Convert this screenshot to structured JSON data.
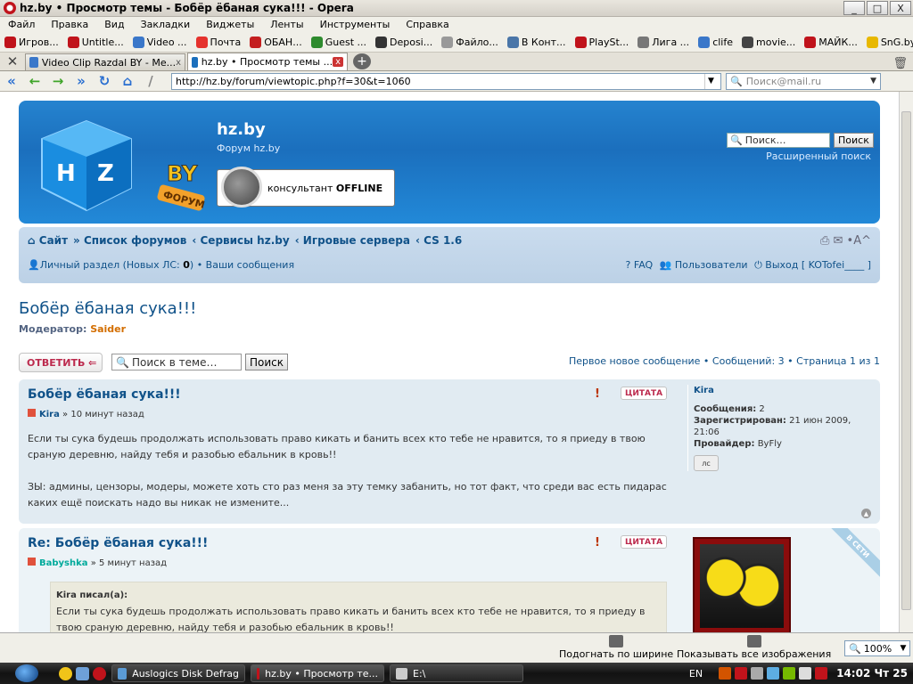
{
  "window": {
    "title": "hz.by • Просмотр темы - Бобёр ёбаная сука!!! - Opera",
    "min": "_",
    "max": "□",
    "close": "X"
  },
  "menu": [
    "Файл",
    "Правка",
    "Вид",
    "Закладки",
    "Виджеты",
    "Ленты",
    "Инструменты",
    "Справка"
  ],
  "bookmarks": [
    {
      "label": "Игров...",
      "color": "#c0131b"
    },
    {
      "label": "Untitle...",
      "color": "#c0131b"
    },
    {
      "label": "Video ...",
      "color": "#3a77c9"
    },
    {
      "label": "Почта",
      "color": "#e5322d"
    },
    {
      "label": "ОБАН...",
      "color": "#c41f1f"
    },
    {
      "label": "Guest ...",
      "color": "#2e8b2e"
    },
    {
      "label": "Deposi...",
      "color": "#333333"
    },
    {
      "label": "Файло...",
      "color": "#999999"
    },
    {
      "label": "В Конт...",
      "color": "#4a76a8"
    },
    {
      "label": "PlaySt...",
      "color": "#c0131b"
    },
    {
      "label": "Лига ...",
      "color": "#777777"
    },
    {
      "label": "clife",
      "color": "#3a77c9"
    },
    {
      "label": "movie...",
      "color": "#444444"
    },
    {
      "label": "МАЙК...",
      "color": "#c0131b"
    },
    {
      "label": "SnG.by",
      "color": "#e8b800"
    }
  ],
  "tabs": [
    {
      "label": "Video Clip Razdal BY - Ме...",
      "active": false
    },
    {
      "label": "hz.by • Просмотр темы ...",
      "active": true
    }
  ],
  "tab_close": "x",
  "tab_add": "+",
  "trash_icon": "🗑",
  "nav": {
    "back_icon": "«",
    "prev_icon": "←",
    "next_icon": "→",
    "fwd_icon": "»",
    "reload_icon": "↻",
    "home_icon": "⌂",
    "wand_icon": "/"
  },
  "address": {
    "url": "http://hz.by/forum/viewtopic.php?f=30&t=1060"
  },
  "search": {
    "placeholder": "Поиск@mail.ru"
  },
  "forum": {
    "site_title": "hz.by",
    "site_desc": "Форум hz.by",
    "consultant_text": "консультант",
    "consultant_status": "OFFLINE",
    "search_placeholder": "Поиск…",
    "search_button": "Поиск",
    "advanced_search": "Расширенный поиск",
    "breadcrumb": [
      "⌂ Сайт",
      "» Список форумов",
      "‹ Сервисы hz.by",
      "‹ Игровые сервера",
      "‹ CS 1.6"
    ],
    "breadcrumb_icons": "⎙  ✉  •A^",
    "private": "Личный раздел (Новых ЛС: ",
    "private_count": "0",
    "private_end": ")",
    "my_messages": " • Ваши сообщения",
    "faq": "FAQ",
    "users": "Пользователи",
    "logout": "Выход [ KOTofei____ ]",
    "topic_title": "Бобёр ёбаная сука!!!",
    "moderator_label": "Модератор: ",
    "moderator_name": "Saider",
    "reply_button": "ОТВЕТИТЬ ⇐",
    "topic_search_placeholder": "Поиск в теме…",
    "topic_search_button": "Поиск",
    "pager": "Первое новое сообщение • Сообщений: 3 • Страница 1 из 1"
  },
  "posts": [
    {
      "title": "Бобёр ёбаная сука!!!",
      "author": "Kira",
      "time": " » 10 минут назад",
      "body": "Если ты сука будешь продолжать использовать право кикать и банить всех кто тебе не нравится, то я приеду в твою сраную деревню, найду тебя и разобью ебальник в кровь!!",
      "body2": "ЗЫ: админы, цензоры, модеры, можете хоть сто раз меня за эту темку забанить, но тот факт, что среди вас есть пидарас каких ещё поискать надо вы никак не измените...",
      "warn": "!",
      "quote_label": "ЦИТАТА",
      "profile_name": "Kira",
      "posts_label": "Сообщения:",
      "posts_count": "2",
      "registered_label": "Зарегистрирован:",
      "registered_value": "21 июн 2009, 21:06",
      "provider_label": "Провайдер:",
      "provider_value": "ByFly",
      "pm_label": "лс",
      "top_icon": "▲"
    },
    {
      "title": "Re: Бобёр ёбаная сука!!!",
      "author": "Babyshka",
      "time": " » 5 минут назад",
      "warn": "!",
      "quote_label": "ЦИТАТА",
      "online_label": "В СЕТИ",
      "quote_cite": "Kira писал(а):",
      "quote_text": "Если ты сука будешь продолжать использовать право кикать и банить всех кто тебе не нравится, то я приеду в твою сраную деревню, найду тебя и разобью ебальник в кровь!!"
    }
  ],
  "statusbar": {
    "fit_width": "Подогнать по ширине",
    "show_images": "Показывать все изображения",
    "zoom": "100%"
  },
  "taskbar": {
    "tasks": [
      {
        "label": "Auslogics Disk Defrag",
        "color": "#5b9bd5",
        "active": false
      },
      {
        "label": "hz.by • Просмотр те...",
        "color": "#c0131b",
        "active": true
      },
      {
        "label": "E:\\",
        "color": "#cccccc",
        "active": false
      }
    ],
    "lang": "EN",
    "clock": "14:02 Чт 25"
  }
}
